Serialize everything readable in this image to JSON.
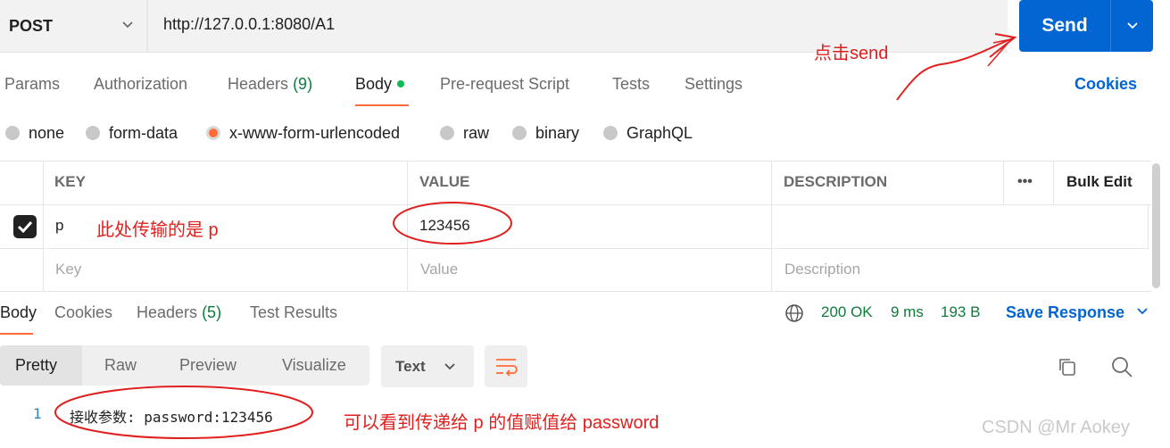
{
  "request": {
    "method": "POST",
    "url": "http://127.0.0.1:8080/A1",
    "send_label": "Send"
  },
  "tabs": [
    {
      "label": "Params"
    },
    {
      "label": "Authorization"
    },
    {
      "label": "Headers",
      "count": "(9)"
    },
    {
      "label": "Body"
    },
    {
      "label": "Pre-request Script"
    },
    {
      "label": "Tests"
    },
    {
      "label": "Settings"
    }
  ],
  "cookies_label": "Cookies",
  "body_types": [
    "none",
    "form-data",
    "x-www-form-urlencoded",
    "raw",
    "binary",
    "GraphQL"
  ],
  "selected_body_type": "x-www-form-urlencoded",
  "table": {
    "headers": {
      "key": "KEY",
      "value": "VALUE",
      "description": "DESCRIPTION",
      "bulk_edit": "Bulk Edit"
    },
    "rows": [
      {
        "key": "p",
        "value": "123456",
        "description": "",
        "checked": true
      }
    ],
    "placeholders": {
      "key": "Key",
      "value": "Value",
      "description": "Description"
    }
  },
  "response": {
    "tabs": [
      {
        "label": "Body"
      },
      {
        "label": "Cookies"
      },
      {
        "label": "Headers",
        "count": "(5)"
      },
      {
        "label": "Test Results"
      }
    ],
    "status": "200 OK",
    "time": "9 ms",
    "size": "193 B",
    "save_label": "Save Response",
    "views": [
      "Pretty",
      "Raw",
      "Preview",
      "Visualize"
    ],
    "format": "Text",
    "lines": [
      {
        "no": "1",
        "text": "接收参数: password:123456"
      }
    ]
  },
  "annotations": {
    "send": "点击send",
    "p": "此处传输的是 p",
    "result": "可以看到传递给 p 的值赋值给 password"
  },
  "watermark": "CSDN @Mr  Aokey",
  "colors": {
    "accent": "#ff6c37",
    "primary": "#0265d2",
    "success": "#0c7c3a",
    "annotation": "#e0201f"
  }
}
